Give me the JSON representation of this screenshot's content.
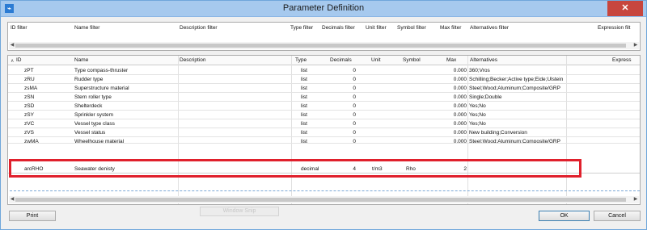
{
  "window": {
    "title": "Parameter Definition",
    "close_glyph": "✕",
    "app_icon": "dialog-icon"
  },
  "filter_headers": [
    "ID filter",
    "Name filter",
    "Description filter",
    "Type filter",
    "Decimals filter",
    "Unit filter",
    "Symbol filter",
    "Max filter",
    "Alternatives filter",
    "Expression filt"
  ],
  "columns": [
    "ID",
    "Name",
    "Description",
    "Type",
    "Decimals",
    "Unit",
    "Symbol",
    "Max",
    "Alternatives",
    "Express"
  ],
  "rows": [
    {
      "id": "zPT",
      "name": "Type compass-thruster",
      "description": "",
      "type": "list",
      "decimals": "0",
      "unit": "",
      "symbol": "",
      "max": "0.000",
      "alternatives": "360;Vros"
    },
    {
      "id": "zRU",
      "name": "Rudder type",
      "description": "",
      "type": "list",
      "decimals": "0",
      "unit": "",
      "symbol": "",
      "max": "0.000",
      "alternatives": "Schilling;Becker;Active type;Eide;Ulstein"
    },
    {
      "id": "zsMA",
      "name": "Superstructure material",
      "description": "",
      "type": "list",
      "decimals": "0",
      "unit": "",
      "symbol": "",
      "max": "0.000",
      "alternatives": "Steel;Wood;Aluminum;Composite/GRP"
    },
    {
      "id": "zSN",
      "name": "Stern roller type",
      "description": "",
      "type": "list",
      "decimals": "0",
      "unit": "",
      "symbol": "",
      "max": "0.000",
      "alternatives": "Single;Double"
    },
    {
      "id": "zSD",
      "name": "Shelterdeck",
      "description": "",
      "type": "list",
      "decimals": "0",
      "unit": "",
      "symbol": "",
      "max": "0.000",
      "alternatives": "Yes;No"
    },
    {
      "id": "zSY",
      "name": "Sprinkler system",
      "description": "",
      "type": "list",
      "decimals": "0",
      "unit": "",
      "symbol": "",
      "max": "0.000",
      "alternatives": "Yes;No"
    },
    {
      "id": "zVC",
      "name": "Vessel type class",
      "description": "",
      "type": "list",
      "decimals": "0",
      "unit": "",
      "symbol": "",
      "max": "0.000",
      "alternatives": "Yes;No"
    },
    {
      "id": "zVS",
      "name": "Vessel status",
      "description": "",
      "type": "list",
      "decimals": "0",
      "unit": "",
      "symbol": "",
      "max": "0.000",
      "alternatives": "New building;Conversion"
    },
    {
      "id": "zwMA",
      "name": "Wheelhouse material",
      "description": "",
      "type": "list",
      "decimals": "0",
      "unit": "",
      "symbol": "",
      "max": "0.000",
      "alternatives": "Steel;Wood;Aluminum;Composite/GRP"
    },
    {
      "id": "arcRHO",
      "name": "Seawater denisty",
      "description": "",
      "type": "decimal",
      "decimals": "4",
      "unit": "t/m3",
      "symbol": "Rho",
      "max": "2",
      "alternatives": ""
    }
  ],
  "buttons": {
    "print": "Print",
    "ok": "OK",
    "cancel": "Cancel",
    "window_snip": "Window Snip"
  },
  "colors": {
    "highlight_border": "#e0202c",
    "titlebar": "#a6c9ee",
    "close_button": "#c7463e"
  }
}
